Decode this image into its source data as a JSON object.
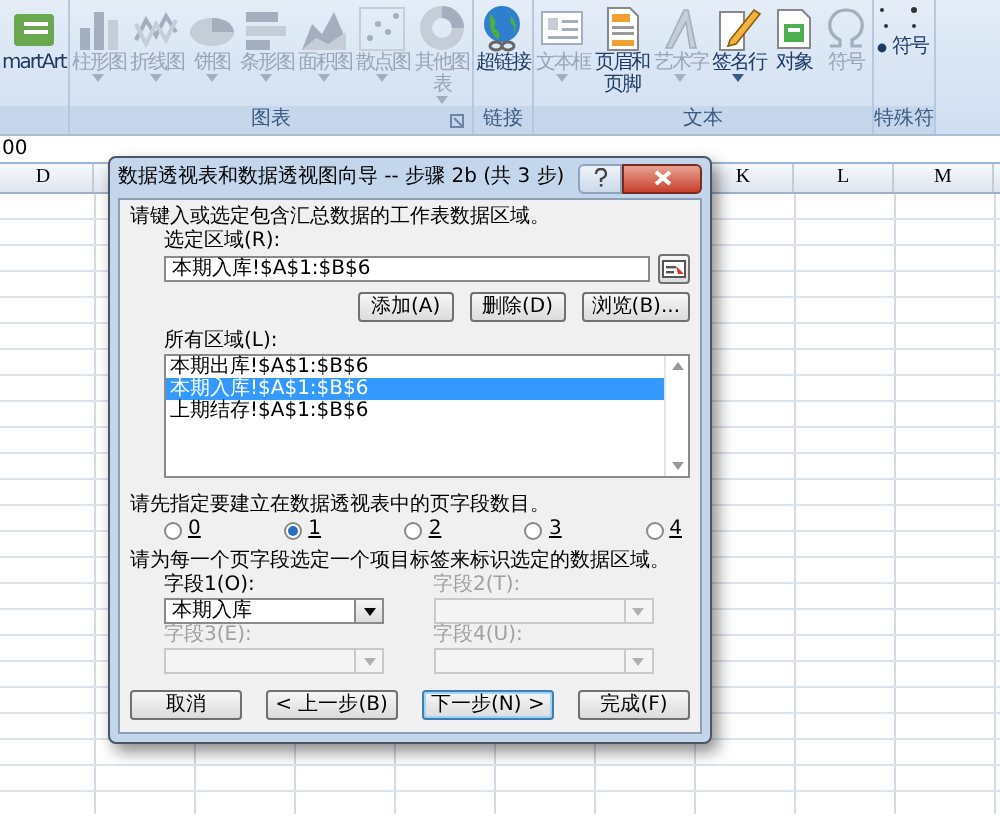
{
  "ribbon": {
    "groups": [
      {
        "items": [
          {
            "label": "martArt",
            "disabled": false,
            "dropdown": false
          }
        ]
      },
      {
        "label": "图表",
        "launcher": true,
        "items": [
          {
            "label": "柱形图",
            "disabled": true,
            "dropdown": true
          },
          {
            "label": "折线图",
            "disabled": true,
            "dropdown": true
          },
          {
            "label": "饼图",
            "disabled": true,
            "dropdown": true
          },
          {
            "label": "条形图",
            "disabled": true,
            "dropdown": true
          },
          {
            "label": "面积图",
            "disabled": true,
            "dropdown": true
          },
          {
            "label": "散点图",
            "disabled": true,
            "dropdown": true
          },
          {
            "label": "其他图表",
            "disabled": true,
            "dropdown": true
          }
        ]
      },
      {
        "label": "链接",
        "items": [
          {
            "label": "超链接",
            "disabled": false,
            "dropdown": false
          }
        ]
      },
      {
        "label": "文本",
        "items": [
          {
            "label": "文本框",
            "disabled": true,
            "dropdown": true
          },
          {
            "label": "页眉和页脚",
            "disabled": false,
            "dropdown": false
          },
          {
            "label": "艺术字",
            "disabled": true,
            "dropdown": true
          },
          {
            "label": "签名行",
            "disabled": false,
            "dropdown": true
          },
          {
            "label": "对象",
            "disabled": false,
            "dropdown": false
          },
          {
            "label": "符号",
            "disabled": true,
            "dropdown": false
          }
        ]
      },
      {
        "label": "特殊符",
        "items": [
          {
            "label": "符号",
            "disabled": false,
            "dropdown": false
          }
        ]
      }
    ]
  },
  "formula_bar": {
    "value": "00"
  },
  "column_headers": [
    "D",
    "K",
    "L",
    "M"
  ],
  "dialog": {
    "title": "数据透视表和数据透视图向导 -- 步骤 2b (共 3 步)",
    "instruction": "请键入或选定包含汇总数据的工作表数据区域。",
    "range_label": "选定区域(R):",
    "range_value": "本期入库!$A$1:$B$6",
    "range_buttons": [
      "添加(A)",
      "删除(D)",
      "浏览(B)..."
    ],
    "areas_label": "所有区域(L):",
    "areas": [
      {
        "text": "本期出库!$A$1:$B$6",
        "selected": false
      },
      {
        "text": "本期入库!$A$1:$B$6",
        "selected": true
      },
      {
        "text": "上期结存!$A$1:$B$6",
        "selected": false
      }
    ],
    "page_field_prompt": "请先指定要建立在数据透视表中的页字段数目。",
    "page_field_counts": [
      {
        "label": "0",
        "selected": false
      },
      {
        "label": "1",
        "selected": true
      },
      {
        "label": "2",
        "selected": false
      },
      {
        "label": "3",
        "selected": false
      },
      {
        "label": "4",
        "selected": false
      }
    ],
    "label_prompt": "请为每一个页字段选定一个项目标签来标识选定的数据区域。",
    "fields": [
      {
        "label": "字段1(O):",
        "value": "本期入库",
        "disabled": false
      },
      {
        "label": "字段2(T):",
        "disabled": true
      },
      {
        "label": "字段3(E):",
        "disabled": true
      },
      {
        "label": "字段4(U):",
        "disabled": true
      }
    ],
    "buttons": [
      {
        "label": "取消",
        "default": false
      },
      {
        "label": "< 上一步(B)",
        "default": false
      },
      {
        "label": "下一步(N) >",
        "default": true
      },
      {
        "label": "完成(F)",
        "default": false
      }
    ]
  }
}
